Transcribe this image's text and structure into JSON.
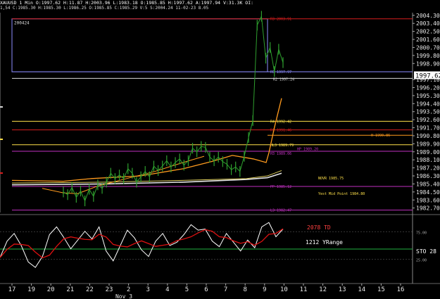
{
  "header": {
    "line1": "XAUUSD 1 Min  O:1997.62  H:11.87  H:2003.96  L:1983.18  O:1985.85  H:1997.62  A:1997.94  V:31.3K  OI:",
    "line2": "1,54  C:1985.30  H:1985.30  L:1986.25  O:1985.85  C:1985.29  V:5  S:2004.24  11-02-23  8.05"
  },
  "colors": {
    "background": "#000000",
    "price": "#2e9e2e",
    "ma_orange": "#ff9a1e",
    "ma_white": "#e6e6e6",
    "ma_yellow": "#e0d060",
    "resistance": "#d81e1e",
    "support": "#d8d8d8",
    "pivot_yellow": "#ffe14a",
    "pivot_purple": "#c030c0",
    "blue_box": "#8c8cff",
    "stoch_white": "#ffffff",
    "stoch_red": "#dd1111",
    "stoch_green": "#20b040"
  },
  "chart_data": {
    "type": "line",
    "ylim": [
      1982.2,
      2004.6
    ],
    "y_ticks": [
      "2004.30",
      "2003.40",
      "2002.50",
      "2001.60",
      "2000.70",
      "1999.80",
      "1998.90",
      "1997.10",
      "1996.20",
      "1995.30",
      "1994.40",
      "1993.50",
      "1992.60",
      "1991.70",
      "1990.80",
      "1989.90",
      "1989.00",
      "1988.10",
      "1987.20",
      "1986.30",
      "1985.40",
      "1984.50",
      "1983.60",
      "1982.70"
    ],
    "current_price": "1997.62",
    "x_labels": [
      "17",
      "19",
      "20",
      "21",
      "22",
      "23",
      "2",
      "3",
      "4",
      "5",
      "6",
      "7",
      "8",
      "9",
      "10",
      "11",
      "12",
      "13",
      "14",
      "15",
      "16"
    ],
    "x_sublabel": "Nov 3",
    "box_label": "200424",
    "levels": [
      {
        "label": "R3 2003.91",
        "y": 2003.91,
        "color": "#d81e1e"
      },
      {
        "label": "R5 1997.97",
        "y": 1997.97,
        "color": "#8c8cff"
      },
      {
        "label": "R2 1997.24",
        "y": 1997.24,
        "color": "#d8d8d8"
      },
      {
        "label": "R4 1992.42",
        "y": 1992.42,
        "color": "#ffe14a"
      },
      {
        "label": "R1 1991.46",
        "y": 1991.46,
        "color": "#d81e1e"
      },
      {
        "label": "H 1990.86",
        "y": 1990.86,
        "color": "#ff9a1e"
      },
      {
        "label": "HL3 1989.79",
        "y": 1989.79,
        "color": "#ffe14a"
      },
      {
        "label": "H3 1989.06",
        "y": 1989.06,
        "color": "#c030c0"
      },
      {
        "label": "HP 1989.20",
        "y": 1989.2,
        "color": "#c030c0"
      },
      {
        "label": "NOVR 1985.75",
        "y": 1985.75,
        "color": "#ffe14a"
      },
      {
        "label": "PP 1985.12",
        "y": 1985.12,
        "color": "#c030c0"
      },
      {
        "label": "Yest Mid Point 1984.80",
        "y": 1984.8,
        "color": "#ffe14a"
      },
      {
        "label": "L3 1982.47",
        "y": 1982.47,
        "color": "#c030c0"
      }
    ],
    "price_series": [
      1984.5,
      1984.2,
      1985.0,
      1983.9,
      1984.6,
      1983.5,
      1984.8,
      1984.0,
      1985.3,
      1984.9,
      1985.6,
      1986.6,
      1986.0,
      1986.4,
      1986.0,
      1987.1,
      1986.6,
      1985.6,
      1986.2,
      1986.8,
      1986.2,
      1987.4,
      1986.9,
      1987.4,
      1988.0,
      1987.3,
      1987.8,
      1988.2,
      1987.5,
      1988.0,
      1989.4,
      1989.0,
      1989.6,
      1989.5,
      1988.4,
      1988.0,
      1988.4,
      1987.9,
      1987.6,
      1987.0,
      1987.3,
      1986.8,
      1988.5,
      1990.6,
      1992.5,
      2003.2,
      2004.2,
      1999.5,
      2000.7,
      1998.0,
      2000.5,
      1999.0
    ],
    "stochastic": {
      "values": [
        28,
        58,
        72,
        50,
        20,
        10,
        30,
        70,
        84,
        65,
        44,
        60,
        76,
        62,
        84,
        40,
        22,
        50,
        78,
        64,
        42,
        30,
        58,
        72,
        50,
        56,
        70,
        88,
        78,
        80,
        58,
        48,
        72,
        56,
        40,
        60,
        46,
        84,
        92,
        66,
        80
      ],
      "signal_label": "2078 TD",
      "range_label": "1212 YRange",
      "name": "STO",
      "last_value": "28",
      "levels": [
        "75.00",
        "25.00"
      ]
    }
  }
}
